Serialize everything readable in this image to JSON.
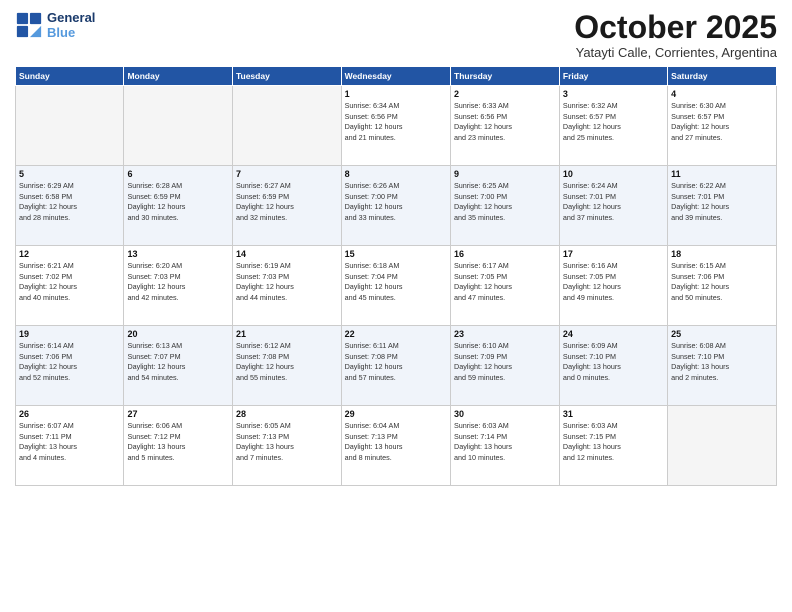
{
  "header": {
    "logo_line1": "General",
    "logo_line2": "Blue",
    "month": "October 2025",
    "location": "Yatayti Calle, Corrientes, Argentina"
  },
  "weekdays": [
    "Sunday",
    "Monday",
    "Tuesday",
    "Wednesday",
    "Thursday",
    "Friday",
    "Saturday"
  ],
  "weeks": [
    [
      {
        "day": "",
        "info": ""
      },
      {
        "day": "",
        "info": ""
      },
      {
        "day": "",
        "info": ""
      },
      {
        "day": "1",
        "info": "Sunrise: 6:34 AM\nSunset: 6:56 PM\nDaylight: 12 hours\nand 21 minutes."
      },
      {
        "day": "2",
        "info": "Sunrise: 6:33 AM\nSunset: 6:56 PM\nDaylight: 12 hours\nand 23 minutes."
      },
      {
        "day": "3",
        "info": "Sunrise: 6:32 AM\nSunset: 6:57 PM\nDaylight: 12 hours\nand 25 minutes."
      },
      {
        "day": "4",
        "info": "Sunrise: 6:30 AM\nSunset: 6:57 PM\nDaylight: 12 hours\nand 27 minutes."
      }
    ],
    [
      {
        "day": "5",
        "info": "Sunrise: 6:29 AM\nSunset: 6:58 PM\nDaylight: 12 hours\nand 28 minutes."
      },
      {
        "day": "6",
        "info": "Sunrise: 6:28 AM\nSunset: 6:59 PM\nDaylight: 12 hours\nand 30 minutes."
      },
      {
        "day": "7",
        "info": "Sunrise: 6:27 AM\nSunset: 6:59 PM\nDaylight: 12 hours\nand 32 minutes."
      },
      {
        "day": "8",
        "info": "Sunrise: 6:26 AM\nSunset: 7:00 PM\nDaylight: 12 hours\nand 33 minutes."
      },
      {
        "day": "9",
        "info": "Sunrise: 6:25 AM\nSunset: 7:00 PM\nDaylight: 12 hours\nand 35 minutes."
      },
      {
        "day": "10",
        "info": "Sunrise: 6:24 AM\nSunset: 7:01 PM\nDaylight: 12 hours\nand 37 minutes."
      },
      {
        "day": "11",
        "info": "Sunrise: 6:22 AM\nSunset: 7:01 PM\nDaylight: 12 hours\nand 39 minutes."
      }
    ],
    [
      {
        "day": "12",
        "info": "Sunrise: 6:21 AM\nSunset: 7:02 PM\nDaylight: 12 hours\nand 40 minutes."
      },
      {
        "day": "13",
        "info": "Sunrise: 6:20 AM\nSunset: 7:03 PM\nDaylight: 12 hours\nand 42 minutes."
      },
      {
        "day": "14",
        "info": "Sunrise: 6:19 AM\nSunset: 7:03 PM\nDaylight: 12 hours\nand 44 minutes."
      },
      {
        "day": "15",
        "info": "Sunrise: 6:18 AM\nSunset: 7:04 PM\nDaylight: 12 hours\nand 45 minutes."
      },
      {
        "day": "16",
        "info": "Sunrise: 6:17 AM\nSunset: 7:05 PM\nDaylight: 12 hours\nand 47 minutes."
      },
      {
        "day": "17",
        "info": "Sunrise: 6:16 AM\nSunset: 7:05 PM\nDaylight: 12 hours\nand 49 minutes."
      },
      {
        "day": "18",
        "info": "Sunrise: 6:15 AM\nSunset: 7:06 PM\nDaylight: 12 hours\nand 50 minutes."
      }
    ],
    [
      {
        "day": "19",
        "info": "Sunrise: 6:14 AM\nSunset: 7:06 PM\nDaylight: 12 hours\nand 52 minutes."
      },
      {
        "day": "20",
        "info": "Sunrise: 6:13 AM\nSunset: 7:07 PM\nDaylight: 12 hours\nand 54 minutes."
      },
      {
        "day": "21",
        "info": "Sunrise: 6:12 AM\nSunset: 7:08 PM\nDaylight: 12 hours\nand 55 minutes."
      },
      {
        "day": "22",
        "info": "Sunrise: 6:11 AM\nSunset: 7:08 PM\nDaylight: 12 hours\nand 57 minutes."
      },
      {
        "day": "23",
        "info": "Sunrise: 6:10 AM\nSunset: 7:09 PM\nDaylight: 12 hours\nand 59 minutes."
      },
      {
        "day": "24",
        "info": "Sunrise: 6:09 AM\nSunset: 7:10 PM\nDaylight: 13 hours\nand 0 minutes."
      },
      {
        "day": "25",
        "info": "Sunrise: 6:08 AM\nSunset: 7:10 PM\nDaylight: 13 hours\nand 2 minutes."
      }
    ],
    [
      {
        "day": "26",
        "info": "Sunrise: 6:07 AM\nSunset: 7:11 PM\nDaylight: 13 hours\nand 4 minutes."
      },
      {
        "day": "27",
        "info": "Sunrise: 6:06 AM\nSunset: 7:12 PM\nDaylight: 13 hours\nand 5 minutes."
      },
      {
        "day": "28",
        "info": "Sunrise: 6:05 AM\nSunset: 7:13 PM\nDaylight: 13 hours\nand 7 minutes."
      },
      {
        "day": "29",
        "info": "Sunrise: 6:04 AM\nSunset: 7:13 PM\nDaylight: 13 hours\nand 8 minutes."
      },
      {
        "day": "30",
        "info": "Sunrise: 6:03 AM\nSunset: 7:14 PM\nDaylight: 13 hours\nand 10 minutes."
      },
      {
        "day": "31",
        "info": "Sunrise: 6:03 AM\nSunset: 7:15 PM\nDaylight: 13 hours\nand 12 minutes."
      },
      {
        "day": "",
        "info": ""
      }
    ]
  ]
}
